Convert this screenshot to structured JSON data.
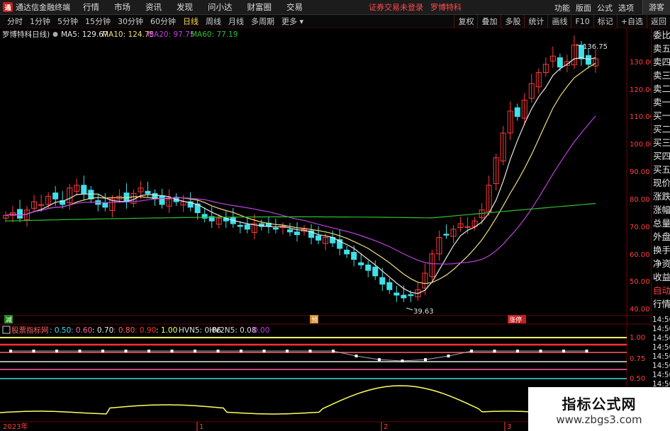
{
  "app": {
    "title": "通达信金融终端",
    "logo_glyph": "通"
  },
  "menu": [
    "行情",
    "市场",
    "资讯",
    "发现",
    "问小达",
    "财富圈",
    "交易"
  ],
  "notice": {
    "login": "证券交易未登录",
    "stock": "罗博特科"
  },
  "right_menu": [
    "功能",
    "版面",
    "公式",
    "选项"
  ],
  "guest_label": "游客",
  "periods": [
    "分时",
    "1分钟",
    "5分钟",
    "15分钟",
    "30分钟",
    "60分钟",
    "日线",
    "周线",
    "月线",
    "多周期",
    "更多"
  ],
  "active_period": "日线",
  "tools": [
    "复权",
    "叠加",
    "多股",
    "统计",
    "画线",
    "F10",
    "标记",
    "+自选",
    "返回"
  ],
  "stock_header": {
    "name": "罗博特科",
    "period": "(日线)",
    "ma5": "MA5: 129.67",
    "ma10": "MA10: 124.75",
    "ma20": "MA20: 97.75",
    "ma60": "MA60: 77.19"
  },
  "colors": {
    "up": "#ff3a3a",
    "down": "#3fe0e8",
    "ma5": "#e8e8e8",
    "ma10": "#f0e080",
    "ma20": "#c040e0",
    "ma60": "#30c030",
    "accent": "#c0201e"
  },
  "price_axis": [
    "130.00",
    "120.00",
    "110.00",
    "100.00",
    "90.00",
    "80.00",
    "70.00",
    "60.00",
    "50.00",
    "40.00"
  ],
  "annotations": {
    "high": "136.75",
    "low": "39.63"
  },
  "markers": [
    "减",
    "预",
    "涨停"
  ],
  "side_panel": [
    "委比",
    "卖五",
    "卖四",
    "卖三",
    "卖二",
    "卖一",
    "买一",
    "买二",
    "买三",
    "买四",
    "买五",
    "现价",
    "涨跌",
    "涨幅",
    "总量",
    "外盘",
    "换手",
    "净资",
    "收益",
    "自动",
    "行情"
  ],
  "time_labels": [
    "14:50",
    "14:50",
    "14:50",
    "14:50",
    "14:50",
    "14:50",
    "14:50",
    "14:50",
    "14:50",
    "14:50",
    "14:50",
    "14:50"
  ],
  "indicator": {
    "name": "股票指标网",
    "params": [
      "0.50",
      "0.60",
      "0.70",
      "0.80",
      "0.90",
      "1.00"
    ],
    "param_colors": [
      "#3fe0e8",
      "#ff60a0",
      "#e8e8e8",
      "#ff6060",
      "#ff3030",
      "#ffff60"
    ],
    "hvn5": "HVN5: 0.86",
    "hv2n5": "HV2N5: 0.08",
    "extra": "0.00",
    "levels": [
      "1.00",
      "0.75",
      "0.50"
    ]
  },
  "date_axis": [
    "2023年",
    "1",
    "2",
    "3"
  ],
  "watermark": {
    "title": "指标公式网",
    "url": "www.zbgs3.com"
  }
}
